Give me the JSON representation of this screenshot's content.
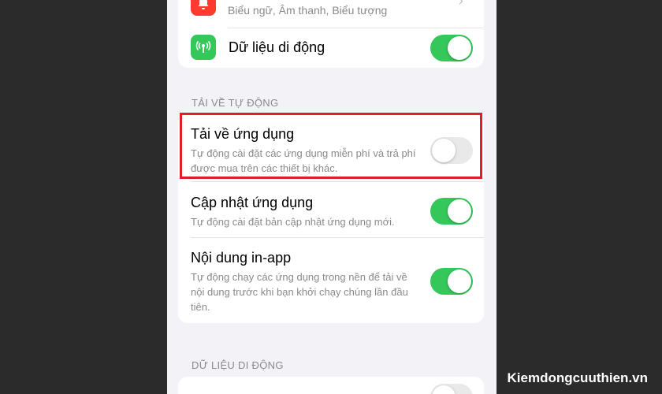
{
  "colors": {
    "toggle_on": "#34c759",
    "toggle_off": "#e9e9ea",
    "highlight_box": "#e11d2b",
    "icon_green": "#34c759",
    "icon_red": "#ff3b30"
  },
  "top_card": {
    "notification_subtitle": "Biểu ngữ, Âm thanh, Biểu tượng",
    "notification_icon": "bell-icon",
    "cellular_label": "Dữ liệu di động",
    "cellular_icon": "antenna-icon",
    "cellular_toggle": "on"
  },
  "auto_download": {
    "header": "TẢI VỀ TỰ ĐỘNG",
    "items": [
      {
        "title": "Tải về ứng dụng",
        "description": "Tự động cài đặt các ứng dụng miễn phí và trả phí được mua trên các thiết bị khác.",
        "toggle": "off"
      },
      {
        "title": "Cập nhật ứng dụng",
        "description": "Tự động cài đặt bản cập nhật ứng dụng mới.",
        "toggle": "on"
      },
      {
        "title": "Nội dung in-app",
        "description": "Tự động chạy các ứng dụng trong nền để tải về nội dung trước khi bạn khởi chạy chúng lần đầu tiên.",
        "toggle": "on"
      }
    ]
  },
  "cellular_section": {
    "header": "DỮ LIỆU DI ĐỘNG"
  },
  "watermark": "Kiemdongcuuthien.vn"
}
